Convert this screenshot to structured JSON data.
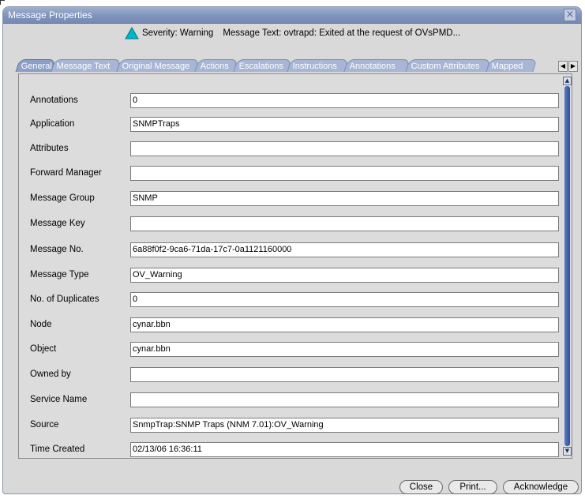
{
  "window": {
    "title": "Message Properties",
    "close_icon": "close-icon"
  },
  "summary": {
    "severity_icon": "warning-triangle-icon",
    "severity_color": "#00b4c8",
    "severity_text": "Severity: Warning",
    "message_text": "Message Text: ovtrapd: Exited at the request of OVsPMD..."
  },
  "tabs": [
    {
      "label": "General",
      "active": true
    },
    {
      "label": "Message Text"
    },
    {
      "label": "Original Message"
    },
    {
      "label": "Actions"
    },
    {
      "label": "Escalations"
    },
    {
      "label": "Instructions"
    },
    {
      "label": "Annotations"
    },
    {
      "label": "Custom Attributes"
    },
    {
      "label": "Mapped"
    }
  ],
  "tab_scroll": {
    "left_icon": "arrow-left-icon",
    "right_icon": "arrow-right-icon"
  },
  "fields": [
    {
      "label": "Annotations",
      "value": "0"
    },
    {
      "label": "Application",
      "value": "SNMPTraps"
    },
    {
      "label": "Attributes",
      "value": ""
    },
    {
      "label": "Forward Manager",
      "value": ""
    },
    {
      "label": "Message Group",
      "value": "SNMP"
    },
    {
      "label": "Message Key",
      "value": ""
    },
    {
      "label": "Message No.",
      "value": "6a88f0f2-9ca6-71da-17c7-0a1121160000"
    },
    {
      "label": "Message Type",
      "value": "OV_Warning"
    },
    {
      "label": "No. of Duplicates",
      "value": "0"
    },
    {
      "label": "Node",
      "value": "cynar.bbn"
    },
    {
      "label": "Object",
      "value": "cynar.bbn"
    },
    {
      "label": "Owned by",
      "value": ""
    },
    {
      "label": "Service Name",
      "value": ""
    },
    {
      "label": "Source",
      "value": "SnmpTrap:SNMP Traps (NNM 7.01):OV_Warning"
    },
    {
      "label": "Time Created",
      "value": "02/13/06 16:36:11"
    }
  ],
  "buttons": {
    "close": "Close",
    "print": "Print...",
    "acknowledge": "Acknowledge"
  }
}
